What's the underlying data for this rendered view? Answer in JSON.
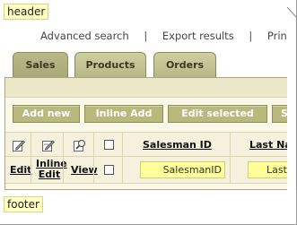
{
  "header_label": "header",
  "footer_label": "footer",
  "toolbar_links": [
    "Advanced search",
    "Export results",
    "Printer"
  ],
  "tabs": [
    {
      "label": "Sales",
      "active": true
    },
    {
      "label": "Products",
      "active": false
    },
    {
      "label": "Orders",
      "active": false
    }
  ],
  "buttons": [
    "Add new",
    "Inline Add",
    "Edit selected",
    "S"
  ],
  "table": {
    "columns": [
      "Salesman ID",
      "Last Name"
    ],
    "row": {
      "edit": "Edit",
      "inline_edit_line1": "Inline",
      "inline_edit_line2": "Edit",
      "view": "View",
      "salesman_id_value": "SalesmanID",
      "last_name_value": "LastName"
    }
  },
  "colors": {
    "tab": "#b8b886",
    "button": "#b9b97d",
    "field": "#ffff9a",
    "tag": "#ffffc2"
  }
}
